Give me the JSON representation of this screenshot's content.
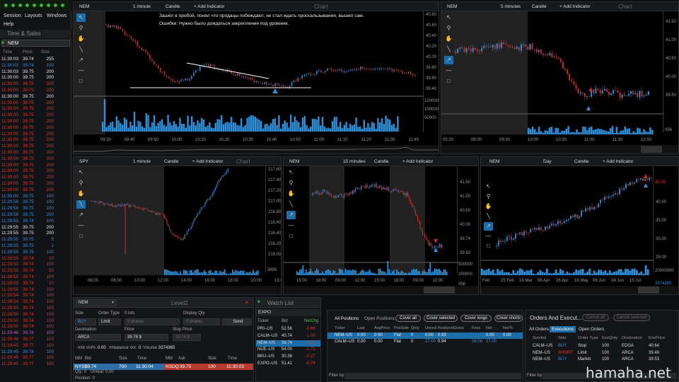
{
  "app": {
    "menu": [
      "Session",
      "Layouts",
      "Windows",
      "Help"
    ]
  },
  "time_sales": {
    "title": "Time & Sales",
    "symbol": "NEM",
    "cols": [
      "Time",
      "Price",
      "Size"
    ],
    "rows": [
      [
        "11:30:03",
        "39.74",
        "255",
        "w"
      ],
      [
        "11:30:03",
        "39.74",
        "100",
        "b"
      ],
      [
        "11:30:03",
        "39.75",
        "200",
        "w"
      ],
      [
        "11:30:00",
        "39.75",
        "200",
        "w"
      ],
      [
        "11:30:00",
        "39.75",
        "200",
        "r"
      ],
      [
        "11:30:00",
        "39.75",
        "200",
        "r"
      ],
      [
        "11:30:00",
        "39.75",
        "200",
        "w"
      ],
      [
        "11:30:00",
        "39.75",
        "200",
        "r"
      ],
      [
        "11:30:00",
        "39.75",
        "200",
        "r"
      ],
      [
        "11:30:00",
        "39.75",
        "200",
        "r"
      ],
      [
        "11:30:00",
        "39.75",
        "200",
        "r"
      ],
      [
        "11:30:00",
        "39.75",
        "200",
        "r"
      ],
      [
        "11:30:00",
        "39.75",
        "200",
        "r"
      ],
      [
        "11:30:00",
        "39.75",
        "200",
        "r"
      ],
      [
        "11:30:00",
        "39.75",
        "200",
        "r"
      ],
      [
        "11:30:00",
        "39.75",
        "200",
        "r"
      ],
      [
        "11:30:00",
        "39.75",
        "200",
        "r"
      ],
      [
        "11:30:00",
        "39.75",
        "200",
        "r"
      ],
      [
        "11:30:00",
        "39.75",
        "200",
        "r"
      ],
      [
        "11:30:00",
        "39.75",
        "200",
        "r"
      ],
      [
        "11:30:00",
        "39.75",
        "200",
        "r"
      ],
      [
        "11:30:00",
        "39.75",
        "200",
        "r"
      ],
      [
        "11:30:00",
        "39.75",
        "100",
        "b"
      ],
      [
        "11:29:58",
        "39.75",
        "100",
        "b"
      ],
      [
        "11:29:58",
        "39.75",
        "100",
        "b"
      ],
      [
        "11:29:58",
        "39.75",
        "200",
        "b"
      ],
      [
        "11:29:55",
        "39.74",
        "100",
        "b"
      ],
      [
        "11:29:55",
        "39.75",
        "200",
        "w"
      ],
      [
        "11:29:55",
        "39.75",
        "200",
        "w"
      ],
      [
        "11:29:55",
        "39.75",
        "5",
        "b"
      ],
      [
        "11:29:55",
        "39.75",
        "1",
        "b"
      ],
      [
        "11:29:55",
        "39.75",
        "100",
        "b"
      ],
      [
        "11:29:55",
        "39.74",
        "10",
        "r"
      ],
      [
        "11:29:55",
        "39.74",
        "100",
        "r"
      ],
      [
        "11:29:55",
        "39.74",
        "50",
        "r"
      ],
      [
        "11:29:55",
        "39.74",
        "100",
        "r"
      ],
      [
        "11:29:55",
        "39.74",
        "10",
        "r"
      ],
      [
        "11:29:55",
        "39.74",
        "100",
        "r"
      ],
      [
        "11:29:54",
        "39.74",
        "100",
        "r"
      ],
      [
        "11:29:54",
        "39.74",
        "100",
        "r"
      ],
      [
        "11:29:50",
        "39.74",
        "100",
        "r"
      ],
      [
        "11:29:50",
        "39.74",
        "100",
        "r"
      ],
      [
        "11:29:50",
        "39.74",
        "100",
        "r"
      ],
      [
        "11:29:50",
        "39.74",
        "100",
        "r"
      ],
      [
        "11:29:46",
        "39.76",
        "100",
        "m"
      ],
      [
        "11:29:46",
        "39.77",
        "100",
        "r"
      ],
      [
        "11:29:45",
        "39.77",
        "100",
        "r"
      ],
      [
        "11:29:45",
        "39.78",
        "100",
        "b"
      ],
      [
        "11:29:45",
        "39.77",
        "100",
        "r"
      ],
      [
        "11:29:45",
        "39.77",
        "100",
        "r"
      ]
    ]
  },
  "chart1": {
    "symbol": "NEM",
    "interval": "1 minute",
    "type": "Candle",
    "add": "+ Add Indicator",
    "title": "Chart",
    "annotation1": "Зашёл в пробой, понял что продацы побеждают, не стал ждать проскальзывания, вышел сам.",
    "annotation2": "Ошибки: Нужно было дождаться закрепления под уровнем.",
    "yticks": [
      "40.80",
      "40.60",
      "40.40",
      "40.20",
      "40.00",
      "39.80",
      "39.60",
      "39.40"
    ],
    "vticks": [
      "150000",
      "100000",
      "50000"
    ],
    "xticks": [
      "09:30",
      "09:40",
      "09:50",
      "10:00",
      "10:10",
      "10:20",
      "10:30",
      "10:40",
      "10:50",
      "11:00",
      "11:10",
      "11:20",
      "11:30",
      "11:40"
    ]
  },
  "chart2": {
    "symbol": "NEM",
    "interval": "5 minutes",
    "type": "Candle",
    "add": "+ Add Indicator",
    "title": "Chart",
    "yticks": [
      "41.50",
      "41.00",
      "40.50",
      "40.00",
      "39.50"
    ],
    "vol": "056",
    "xticks": [
      "05:20",
      "06:00",
      "09:30",
      "10:00",
      "10:30",
      "11:00",
      "11:30",
      "12:00"
    ]
  },
  "chart3": {
    "symbol": "SPY",
    "interval": "1 minute",
    "type": "Candle",
    "add": "+ Add Indicator",
    "title": "Chart",
    "yticks": [
      "217.60",
      "217.40",
      "217.20",
      "217.00",
      "216.80",
      "216.60",
      "216.40",
      "216.20",
      "216.00"
    ],
    "vol": "3895",
    "xticks": [
      "06:00",
      "08:00",
      "10:00",
      "12:00",
      "14:00",
      "16:00",
      "18:00",
      "20:00",
      "13.00"
    ]
  },
  "chart4": {
    "symbol": "NEM",
    "interval": "15 minutes",
    "type": "Candle",
    "add": "+ Add Indicator",
    "yticks": [
      "41.50",
      "41.00",
      "40.50",
      "40.00",
      "39.74",
      "39.50"
    ],
    "vticks": [
      "500000",
      "250000"
    ],
    "vol": "056",
    "xticks": [
      "15:00",
      "18:00",
      "09:00",
      "12:00",
      "15:00",
      "18:00",
      "09:00",
      "12:00"
    ]
  },
  "chart5": {
    "symbol": "NEM",
    "interval": "Day",
    "type": "Candle",
    "add": "+ Add Indicator",
    "yticks": [
      "40.00",
      "35.00",
      "30.00",
      "25.00"
    ],
    "price": "82.09",
    "vticks": [
      "20000000"
    ],
    "vol": "3374265",
    "xticks": [
      "Feb",
      "25 Feb",
      "16 Mar",
      "06 Apr",
      "26 Apr",
      "16 May",
      "06 Jun",
      "24 Jun",
      "15 Jul"
    ]
  },
  "level2": {
    "symbol": "NEM",
    "title": "Level2",
    "side_label": "Side",
    "order_type_label": "Order Type",
    "size_label": "0 lots",
    "display_label": "Display Qty",
    "side": "BUY",
    "order_type": "Limit",
    "shares_ph": "0 shares",
    "display_ph": "0 shares",
    "send": "Send",
    "dest_label": "Destination",
    "price_label": "Price",
    "stop_label": "Stop Price",
    "dest": "ARCA",
    "price": "39.78 $",
    "stop": "39.78 $",
    "imb": "Imb Vol%:",
    "imb_v": "0.00",
    "imbv_label": "Imbalance Vol:",
    "imbv": "0",
    "volume_label": "Volume:",
    "volume": "3374365",
    "cols": [
      "MM",
      "Bid",
      "Size",
      "Time",
      "MM",
      "Ask",
      "Size",
      "Time"
    ],
    "bid": [
      "NYSE",
      "39.74",
      "700",
      "11:30:04"
    ],
    "ask": [
      "NSDQ",
      "39.75",
      "100",
      "11:30:03"
    ],
    "qty": "Qty: 0",
    "unreal": "Unreal: 0.00",
    "position": "Position: 0"
  },
  "watch": {
    "title": "Watch List",
    "list": "EXPO",
    "cols": [
      "Ticker",
      "Bid",
      "NetChg"
    ],
    "rows": [
      [
        "PRI–US",
        "52.56",
        "-0.66"
      ],
      [
        "CALM–US",
        "40.74",
        "-1.00"
      ],
      [
        "NEM–US",
        "39.74",
        "-1.96"
      ],
      [
        "NUE–US",
        "54.00",
        "-1.71"
      ],
      [
        "BKU–US",
        "30.36",
        "-0.27"
      ],
      [
        "EXPO–US",
        "51.41",
        "-0.74"
      ]
    ]
  },
  "positions": {
    "tab1": "All Positions",
    "tab2": "Open Positions",
    "buttons": [
      "Cover all",
      "Cover selected",
      "Cover longs",
      "Cover shorts"
    ],
    "cols": [
      "Ticker",
      "Last",
      "AvgPrice",
      "PosSide",
      "Qnty",
      "Unreal",
      "RealizedGross",
      "Fees",
      "Net",
      "Net%"
    ],
    "rows": [
      [
        "NEM–US",
        "0.00",
        "0.00",
        "Flat",
        "0",
        "0.00",
        "0.93",
        "",
        "0.00",
        "0.00"
      ],
      [
        "CALM–US",
        "0.00",
        "0.00",
        "Flat",
        "0",
        "27.00",
        "0.94",
        "26.08",
        "27.00",
        ""
      ]
    ],
    "filter": "Filter by"
  },
  "orders": {
    "title": "Orders And Execut...",
    "cancel_all": "Cancel all",
    "cancel_sel": "Cancel selected",
    "tabs": [
      "All Orders",
      "Executions",
      "Open Orders"
    ],
    "cols": [
      "Symbol",
      "Side",
      "Order Type",
      "ExeQnty",
      "Destination",
      "ExePrice"
    ],
    "rows": [
      [
        "CALM–US",
        "BUY",
        "Stop",
        "100",
        "EDGA",
        "40.64"
      ],
      [
        "NEM–US",
        "SHORT",
        "Limit",
        "100",
        "ARCA",
        "39.48"
      ],
      [
        "NEM–US",
        "BUY",
        "Market",
        "100",
        "ARCA",
        "39.53"
      ]
    ],
    "filter": "Filter by"
  },
  "watermark": "hamaha.net"
}
